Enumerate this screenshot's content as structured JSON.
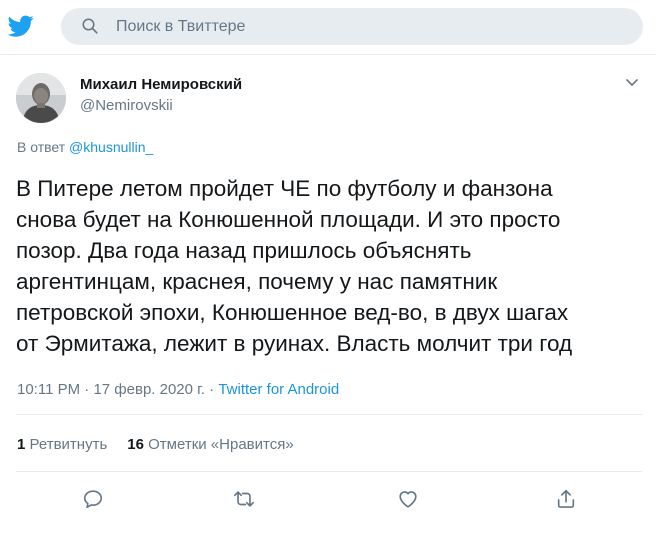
{
  "search": {
    "placeholder": "Поиск в Твиттере"
  },
  "tweet": {
    "author_name": "Михаил Немировский",
    "author_handle": "@Nemirovskii",
    "reply_prefix": "В ответ",
    "reply_to": "@khusnullin_",
    "text": "В Питере летом пройдет ЧЕ по футболу и фанзона\nснова будет на Конюшенной площади. И это просто\nпозор. Два года назад пришлось объяснять\nаргентинцам, краснея, почему у нас памятник\nпетровской эпохи, Конюшенное вед-во, в двух шагах\nот Эрмитажа, лежит в руинах. Власть молчит три год",
    "time": "10:11 PM",
    "date": "17 февр. 2020 г.",
    "separator": "·",
    "source": "Twitter for Android",
    "retweets_count": "1",
    "retweets_label": "Ретвитнуть",
    "likes_count": "16",
    "likes_label": "Отметки «Нравится»"
  },
  "icons": {
    "logo": "twitter-bird-icon",
    "search": "search-icon",
    "caret": "chevron-down-icon",
    "reply": "reply-icon",
    "retweet": "retweet-icon",
    "like": "heart-icon",
    "share": "share-icon"
  },
  "colors": {
    "brand": "#1da1f2",
    "link": "#1b95e0",
    "secondary_text": "#657786",
    "search_bg": "#e6ecf0"
  }
}
